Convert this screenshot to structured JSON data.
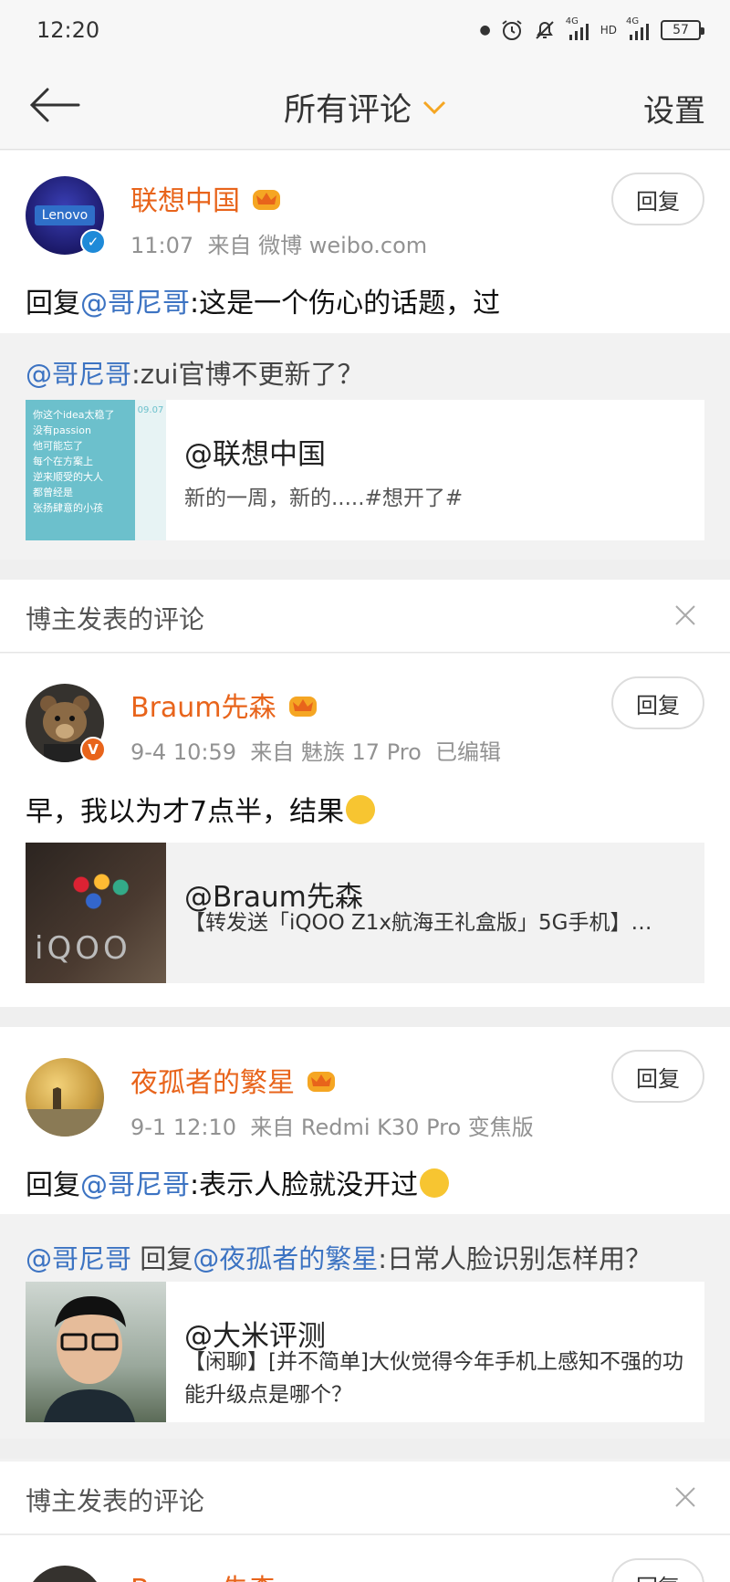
{
  "status": {
    "time": "12:20",
    "battery": "57",
    "net1": "4G",
    "net2": "4G",
    "hd": "HD"
  },
  "nav": {
    "title": "所有评论",
    "settings": "设置"
  },
  "colors": {
    "accent_orange": "#e8641b",
    "link_blue": "#3c73c2",
    "verified_blue": "#1e8ad8",
    "verified_orange": "#f5a623"
  },
  "comments": [
    {
      "user": "联想中国",
      "time": "11:07",
      "source": "来自 微博 weibo.com",
      "reply_label": "回复",
      "text_prefix": "回复",
      "text_at": "@哥尼哥",
      "text_body": ":这是一个伤心的话题，过",
      "quote_at": "@哥尼哥",
      "quote_body": ":zui官博不更新了？",
      "card_title": "@联想中国",
      "card_desc": "新的一周，新的.....#想开了#",
      "avatar_logo": "Lenovo",
      "thumb_lines": [
        "你这个idea太稳了",
        "没有passion",
        "他可能忘了",
        "每个在方案上",
        "逆来顺受的大人",
        "都曾经是",
        "张扬肆意的小孩"
      ],
      "thumb_date": "09.07"
    },
    {
      "user": "Braum先森",
      "time": "9-4 10:59",
      "source": "来自 魅族 17 Pro",
      "edited": "已编辑",
      "reply_label": "回复",
      "text_body": "早，我以为才7点半，结果",
      "card_title": "@Braum先森",
      "card_desc": "【转发送「iQOO Z1x航海王礼盒版」5G手机】…",
      "thumb_logo": "iQOO"
    },
    {
      "user": "夜孤者的繁星",
      "time": "9-1 12:10",
      "source": "来自 Redmi K30 Pro 变焦版",
      "reply_label": "回复",
      "text_prefix": "回复",
      "text_at": "@哥尼哥",
      "text_body": ":表示人脸就没开过",
      "quote_at1": "@哥尼哥",
      "quote_mid": " 回复",
      "quote_at2": "@夜孤者的繁星",
      "quote_body": ":日常人脸识别怎样用？",
      "card_title": "@大米评测",
      "card_desc": "【闲聊】[并不简单]大伙觉得今年手机上感知不强的功能升级点是哪个？"
    }
  ],
  "section_label": "博主发表的评论",
  "partial_user": "Braum先森",
  "partial_reply": "回复",
  "icons": [
    "back-arrow-icon",
    "chevron-down-icon",
    "crown-icon",
    "verified-icon",
    "close-icon",
    "alarm-icon",
    "mute-icon",
    "signal-icon"
  ]
}
